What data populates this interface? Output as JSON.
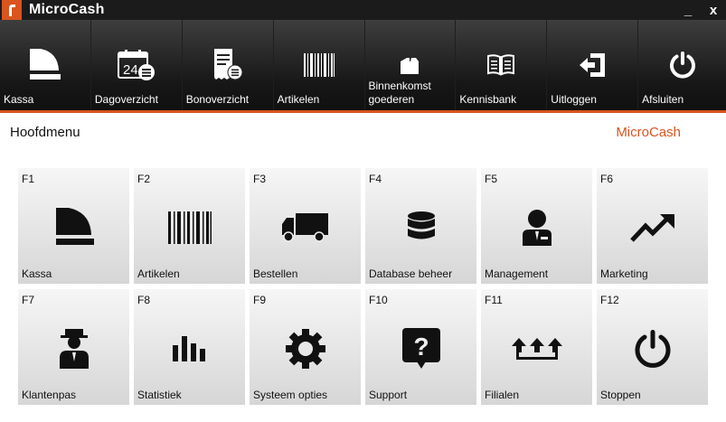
{
  "window": {
    "title": "MicroCash",
    "minimize": "_",
    "close": "x"
  },
  "toolbar": [
    {
      "id": "kassa",
      "label": "Kassa",
      "icon": "register-icon"
    },
    {
      "id": "dagoverzicht",
      "label": "Dagoverzicht",
      "icon": "calendar-list-icon"
    },
    {
      "id": "bonoverzicht",
      "label": "Bonoverzicht",
      "icon": "receipt-icon"
    },
    {
      "id": "artikelen",
      "label": "Artikelen",
      "icon": "barcode-icon"
    },
    {
      "id": "binnenkomst",
      "label": "Binnenkomst goederen",
      "icon": "box-icon"
    },
    {
      "id": "kennisbank",
      "label": "Kennisbank",
      "icon": "book-icon"
    },
    {
      "id": "uitloggen",
      "label": "Uitloggen",
      "icon": "logout-icon"
    },
    {
      "id": "afsluiten",
      "label": "Afsluiten",
      "icon": "power-icon"
    }
  ],
  "main": {
    "title": "Hoofdmenu",
    "brand": "MicroCash",
    "accent_color": "#d9541e",
    "tiles": [
      {
        "key": "F1",
        "label": "Kassa",
        "icon": "register-icon"
      },
      {
        "key": "F2",
        "label": "Artikelen",
        "icon": "barcode-icon"
      },
      {
        "key": "F3",
        "label": "Bestellen",
        "icon": "truck-icon"
      },
      {
        "key": "F4",
        "label": "Database beheer",
        "icon": "database-icon"
      },
      {
        "key": "F5",
        "label": "Management",
        "icon": "manager-icon"
      },
      {
        "key": "F6",
        "label": "Marketing",
        "icon": "trend-up-icon"
      },
      {
        "key": "F7",
        "label": "Klantenpas",
        "icon": "customer-icon"
      },
      {
        "key": "F8",
        "label": "Statistiek",
        "icon": "bar-chart-icon"
      },
      {
        "key": "F9",
        "label": "Systeem opties",
        "icon": "gear-icon"
      },
      {
        "key": "F10",
        "label": "Support",
        "icon": "help-icon"
      },
      {
        "key": "F11",
        "label": "Filialen",
        "icon": "branches-icon"
      },
      {
        "key": "F12",
        "label": "Stoppen",
        "icon": "power-icon"
      }
    ]
  }
}
